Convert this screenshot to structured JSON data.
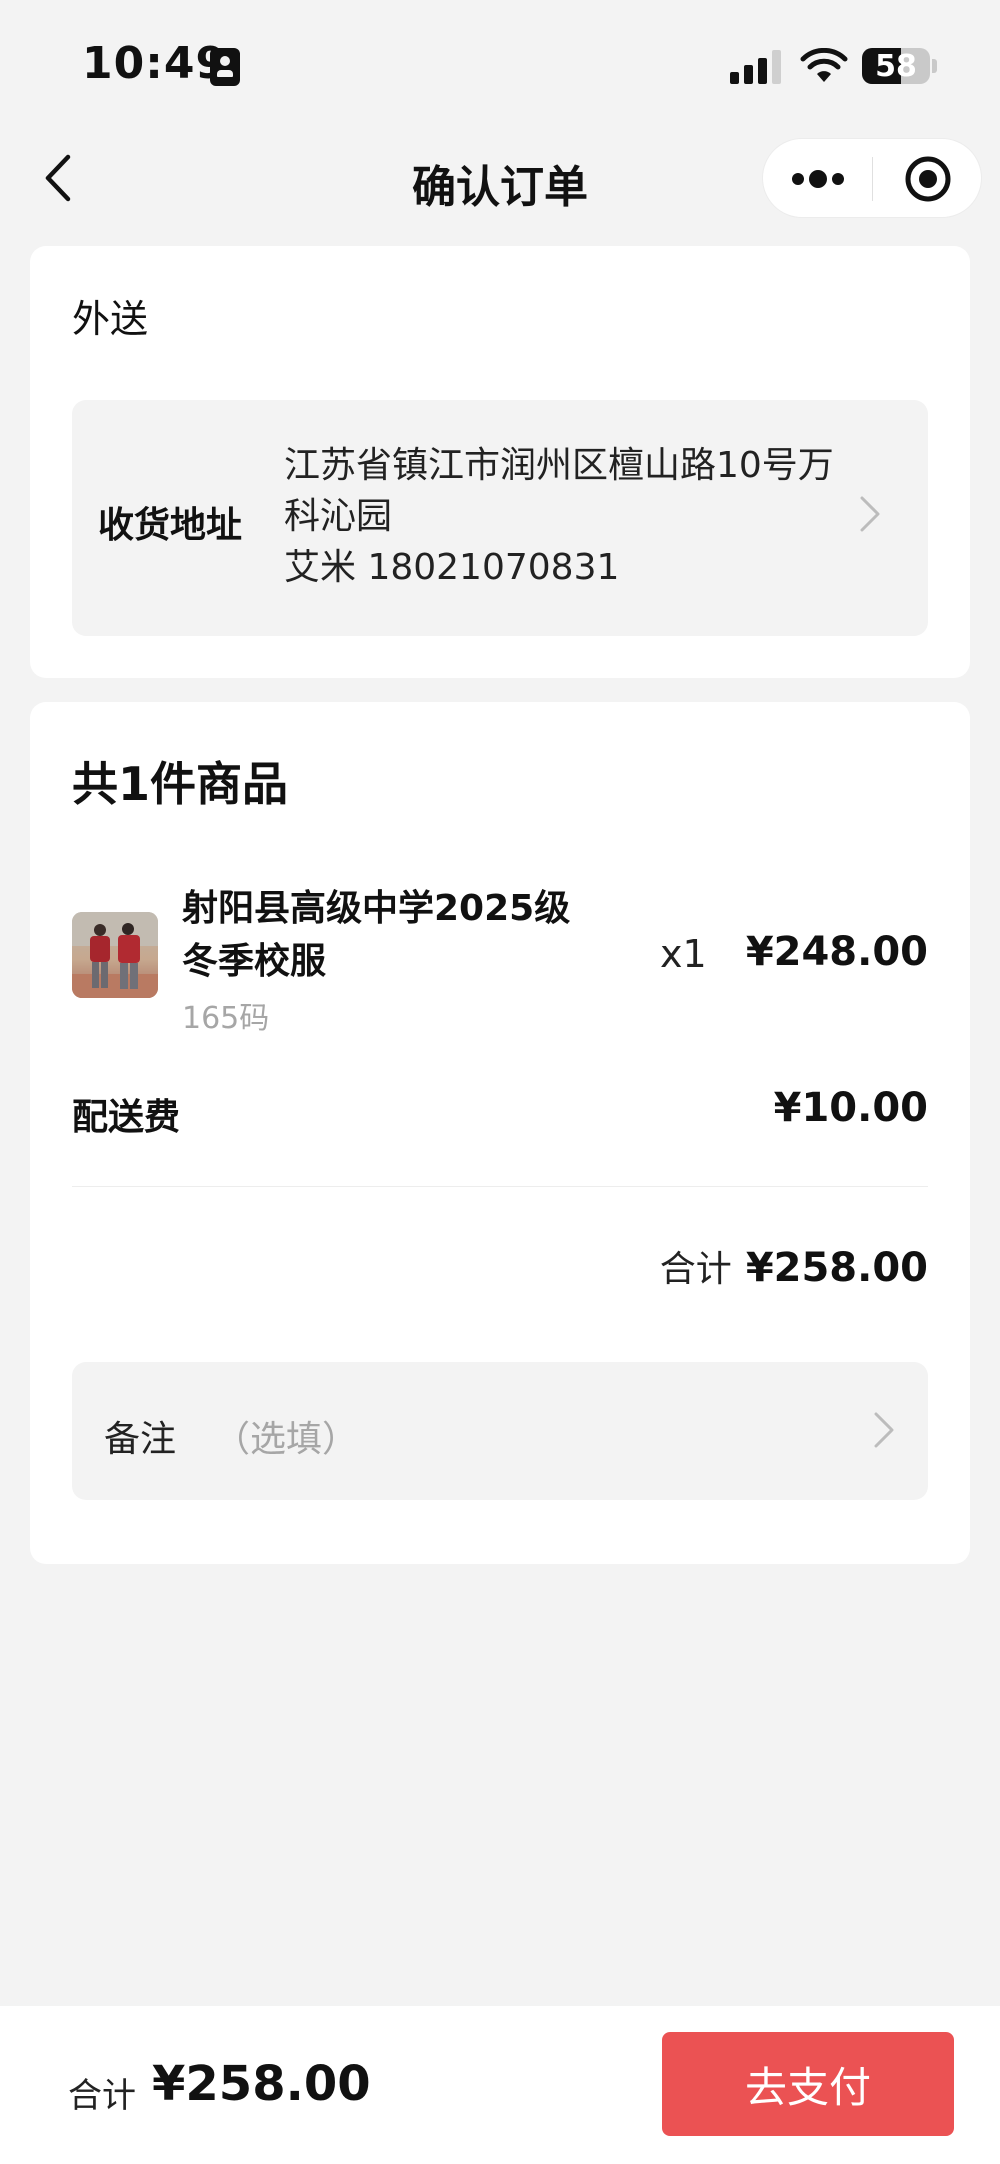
{
  "status_bar": {
    "time": "10:49",
    "battery_level": "58",
    "battery_fraction": 0.58,
    "icons": [
      "contact-card-icon",
      "cellular-signal-icon",
      "wifi-icon",
      "battery-icon"
    ]
  },
  "nav": {
    "title": "确认订单",
    "icons": [
      "chevron-left-icon",
      "more-dots-icon",
      "target-circle-icon"
    ]
  },
  "delivery": {
    "mode_label": "外送"
  },
  "address": {
    "label": "收货地址",
    "line1": "江苏省镇江市润州区檀山路10号万",
    "line2": "科沁园",
    "contact": "艾米 18021070831"
  },
  "goods": {
    "count_label": "共1件商品",
    "items": [
      {
        "name_line1": "射阳县高级中学2025级",
        "name_line2": "冬季校服",
        "spec": "165码",
        "quantity": "x1",
        "price": "¥248.00"
      }
    ],
    "shipping_label": "配送费",
    "shipping_fee": "¥10.00",
    "subtotal_label": "合计",
    "subtotal": "¥258.00"
  },
  "remark": {
    "label": "备注",
    "placeholder": "（选填）"
  },
  "footer": {
    "total_label": "合计",
    "total": "¥258.00",
    "pay_label": "去支付"
  },
  "colors": {
    "background": "#f3f3f3",
    "card": "#ffffff",
    "accent": "#eb5253",
    "muted_text": "#a6a6a6"
  }
}
